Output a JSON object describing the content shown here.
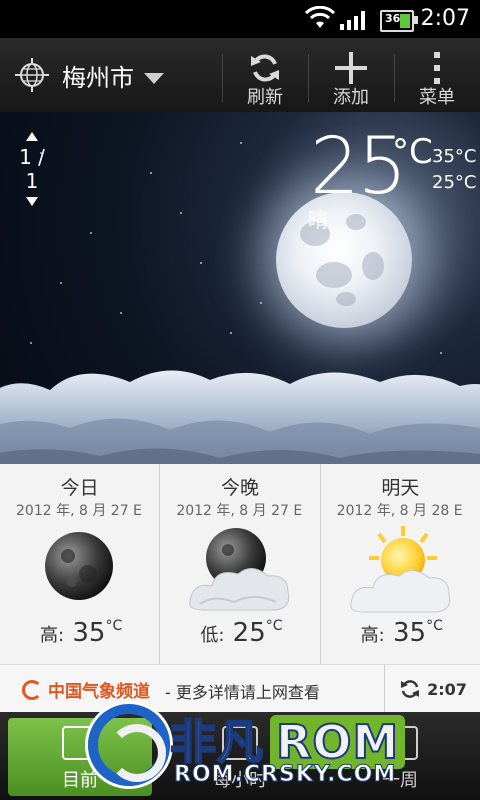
{
  "status_bar": {
    "battery": "36",
    "time": "2:07"
  },
  "action_bar": {
    "location": "梅州市",
    "buttons": {
      "refresh": "刷新",
      "add": "添加",
      "menu": "菜单"
    }
  },
  "current": {
    "page_indicator": "1 / 1",
    "temperature": "25",
    "unit": "°C",
    "high": "35°C",
    "low": "25°C",
    "condition": "晴"
  },
  "forecast": [
    {
      "title": "今日",
      "date": "2012 年, 8 月 27 E",
      "temp_label": "高:",
      "temp": "35",
      "unit": "°C",
      "icon": "moon-icon"
    },
    {
      "title": "今晚",
      "date": "2012 年, 8 月 27 E",
      "temp_label": "低:",
      "temp": "25",
      "unit": "°C",
      "icon": "moon-cloud-icon"
    },
    {
      "title": "明天",
      "date": "2012 年, 8 月 28 E",
      "temp_label": "高:",
      "temp": "35",
      "unit": "°C",
      "icon": "sun-cloud-icon"
    }
  ],
  "info_bar": {
    "provider": "中国气象频道",
    "link_text": "- 更多详情请上网查看",
    "updated_time": "2:07"
  },
  "tabs": [
    {
      "label": "目前",
      "active": true
    },
    {
      "label": "每小时",
      "active": false
    },
    {
      "label": "一周",
      "active": false
    }
  ],
  "watermark": {
    "brand": "非凡",
    "rom": "ROM",
    "url": "ROM.CRSKY.COM"
  },
  "colors": {
    "accent_green": "#5fa832",
    "provider_orange": "#e0561f"
  }
}
